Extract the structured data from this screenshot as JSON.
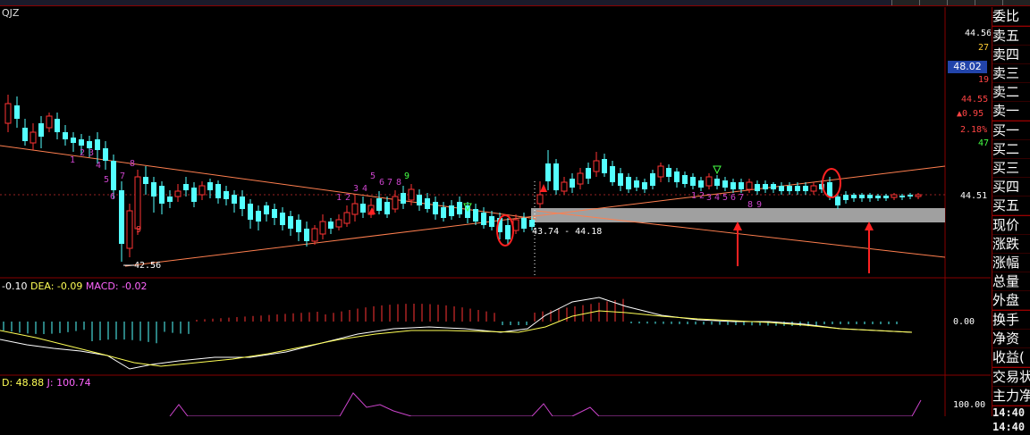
{
  "window": {
    "symbol": "QJZ"
  },
  "price_axis": {
    "top_price": "44.56",
    "top_vol": "27",
    "mid_vol": "19",
    "sell1_price": "44.55",
    "change": "▲0.95",
    "change_pct": "2.18%",
    "vol_47": "47",
    "current_line_price": "44.51",
    "tag": "48.02"
  },
  "annotations": {
    "low_label": "42.56",
    "range_label": "43.74 - 44.18",
    "low_digit": "9"
  },
  "macd": {
    "dif_label": "-0.10",
    "dea_label": "DEA: -0.09",
    "macd_label": "MACD: -0.02",
    "zero_label": "0.00"
  },
  "kdj": {
    "d_label": "D: 48.88",
    "j_label": "J: 100.74",
    "top_label": "100.00"
  },
  "side_panel": {
    "items": [
      "委比",
      "卖五",
      "卖四",
      "卖三",
      "卖二",
      "卖一",
      "买一",
      "买二",
      "买三",
      "买四",
      "买五",
      "现价",
      "涨跌",
      "涨幅",
      "总量",
      "外盘",
      "换手",
      "净资",
      "收益(",
      "交易状",
      "主力净"
    ],
    "times": [
      "14:40",
      "14:40"
    ]
  },
  "colors": {
    "up": "#ff3333",
    "down": "#54ffff",
    "trend": "#ff7f4f",
    "macd_line": "#ffffff",
    "signal_line": "#ffff55",
    "magenta": "#cc44cc",
    "gray_band": "#a0a0a0"
  }
}
